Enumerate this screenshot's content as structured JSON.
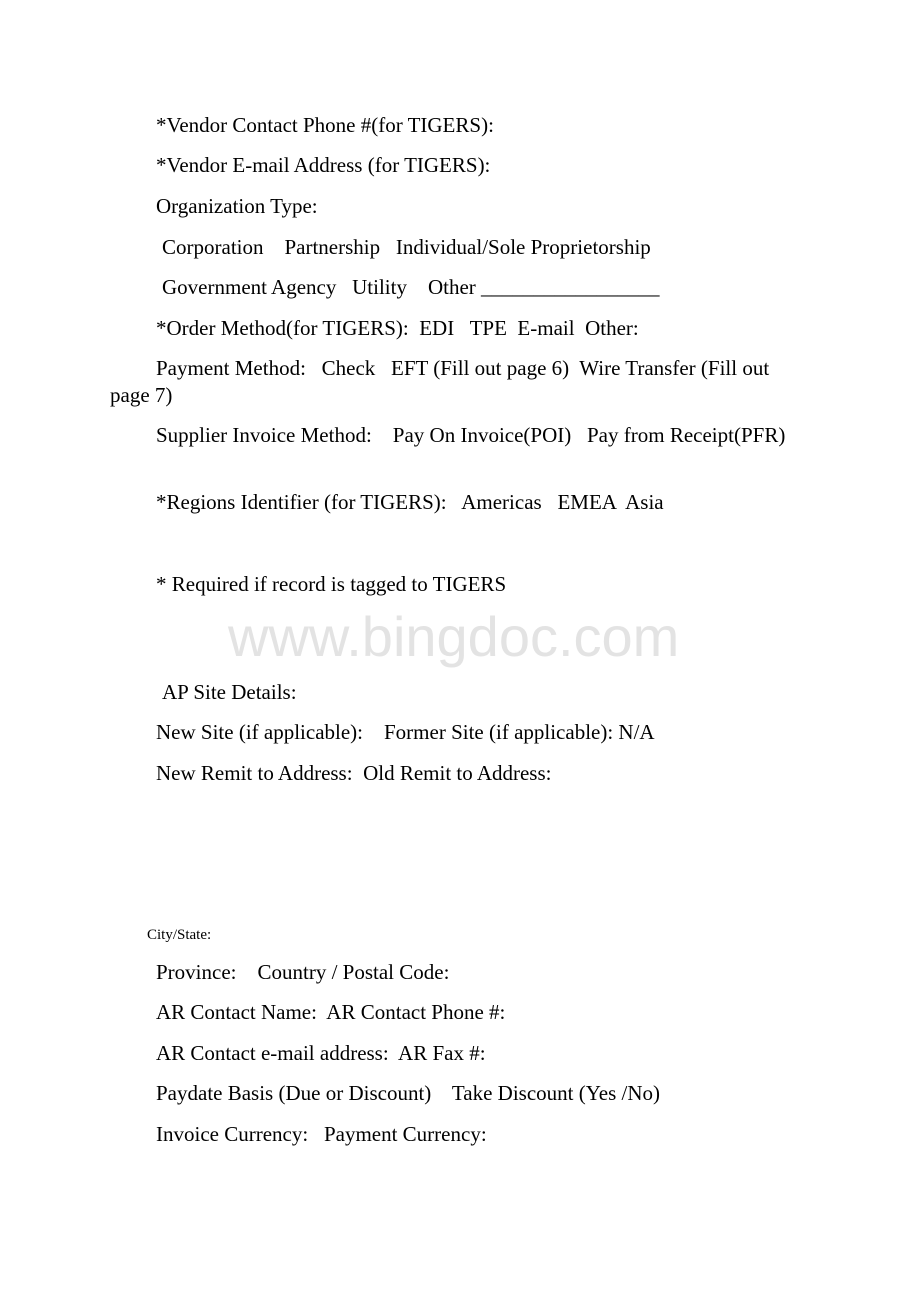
{
  "document": {
    "vendor_contact_phone": "*Vendor Contact Phone #(for TIGERS):",
    "vendor_email": "*Vendor E-mail Address (for TIGERS):",
    "organization_type": {
      "label": "Organization Type:",
      "row1": "Corporation    Partnership   Individual/Sole Proprietorship",
      "row2": "Government Agency   Utility    Other _________________"
    },
    "order_method": "*Order Method(for TIGERS):  EDI   TPE  E-mail  Other:",
    "payment_method": "Payment Method:   Check   EFT (Fill out page 6)  Wire Transfer (Fill out page 7)",
    "supplier_invoice_method": "Supplier Invoice Method:    Pay On Invoice(POI)   Pay from Receipt(PFR)",
    "regions_identifier": "*Regions Identifier (for TIGERS):   Americas   EMEA  Asia",
    "required_note": "* Required if record is tagged to TIGERS",
    "watermark": "www.bingdoc.com",
    "ap_site_details": "AP Site Details:",
    "site_line": "New Site (if applicable):    Former Site (if applicable): N/A",
    "remit_line": "New Remit to Address:  Old Remit to Address:",
    "city_state": "City/State:",
    "province_line": "Province:    Country / Postal Code:",
    "ar_contact_line": "AR Contact Name:  AR Contact Phone #:",
    "ar_email_line": "AR Contact e-mail address:  AR Fax #:",
    "paydate_line": "Paydate Basis (Due or Discount)    Take Discount (Yes /No)",
    "currency_line": "Invoice Currency:   Payment Currency:"
  }
}
